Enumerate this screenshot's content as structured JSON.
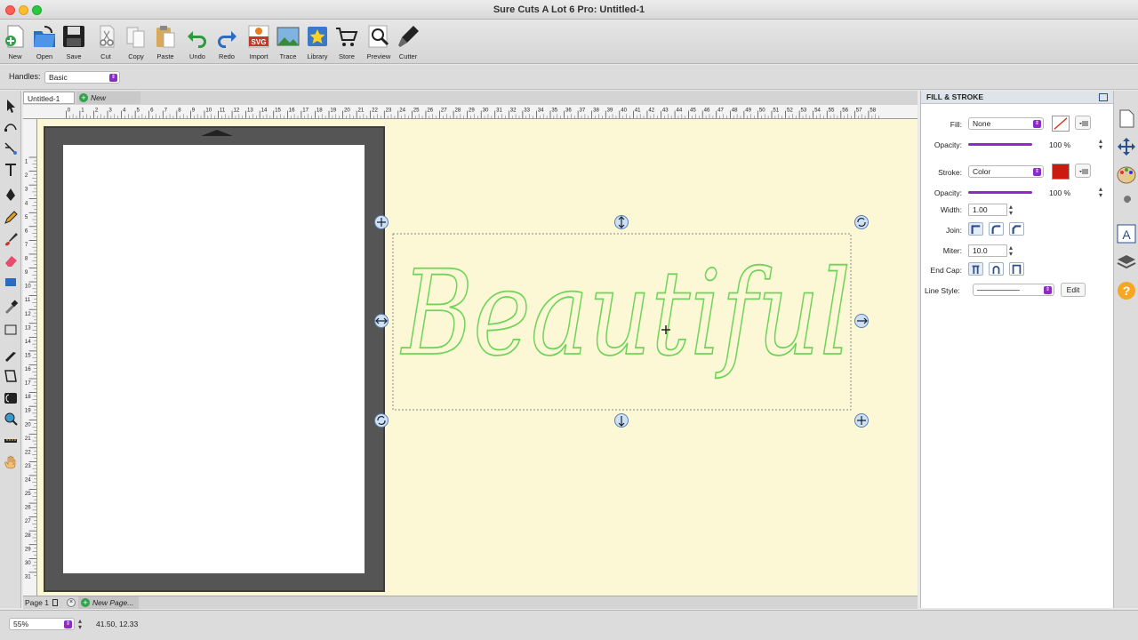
{
  "window": {
    "title": "Sure Cuts A Lot 6 Pro: Untitled-1"
  },
  "toolbar": {
    "items": [
      {
        "label": "New",
        "icon": "new-icon"
      },
      {
        "label": "Open",
        "icon": "open-icon"
      },
      {
        "label": "Save",
        "icon": "save-icon"
      },
      {
        "label": "Cut",
        "icon": "cut-icon"
      },
      {
        "label": "Copy",
        "icon": "copy-icon"
      },
      {
        "label": "Paste",
        "icon": "paste-icon"
      },
      {
        "label": "Undo",
        "icon": "undo-icon"
      },
      {
        "label": "Redo",
        "icon": "redo-icon"
      },
      {
        "label": "Import",
        "icon": "import-svg-icon"
      },
      {
        "label": "Trace",
        "icon": "trace-icon"
      },
      {
        "label": "Library",
        "icon": "library-icon"
      },
      {
        "label": "Store",
        "icon": "store-cart-icon"
      },
      {
        "label": "Preview",
        "icon": "preview-magnifier-icon"
      },
      {
        "label": "Cutter",
        "icon": "cutter-blade-icon"
      }
    ]
  },
  "options": {
    "handles_label": "Handles:",
    "handles_value": "Basic"
  },
  "tabs": {
    "current": "Untitled-1",
    "new_project": "New Project..."
  },
  "ruler": {
    "top_numbers": [
      "0",
      "1",
      "2",
      "3",
      "4",
      "5",
      "6",
      "7",
      "8",
      "9",
      "10",
      "11",
      "12",
      "13",
      "14",
      "15",
      "16",
      "17",
      "18",
      "19",
      "20",
      "21",
      "22",
      "23",
      "24",
      "25",
      "26",
      "27",
      "28",
      "29",
      "30",
      "31",
      "32",
      "33",
      "34",
      "35",
      "36",
      "37",
      "38",
      "39",
      "40",
      "41",
      "42",
      "43",
      "44",
      "45",
      "46",
      "47",
      "48",
      "49",
      "50",
      "51",
      "52",
      "53",
      "54",
      "55",
      "56",
      "57",
      "58"
    ],
    "left_numbers": [
      "1",
      "2",
      "3",
      "4",
      "5",
      "6",
      "7",
      "8",
      "9",
      "10",
      "11",
      "12",
      "13",
      "14",
      "15",
      "16",
      "17",
      "18",
      "19",
      "20",
      "21",
      "22",
      "23",
      "24",
      "25",
      "26",
      "27",
      "28",
      "29",
      "30",
      "31",
      "32"
    ]
  },
  "canvas": {
    "text": "Beautiful",
    "text_color": "#6fd35a",
    "background": "#fcf8d6"
  },
  "pages": {
    "page_label": "Page 1",
    "new_page": "New Page..."
  },
  "status": {
    "zoom": "55%",
    "coords": "41.50, 12.33"
  },
  "panel": {
    "title": "FILL & STROKE",
    "fill_label": "Fill:",
    "fill_value": "None",
    "opacity_label": "Opacity:",
    "fill_opacity": "100 %",
    "stroke_label": "Stroke:",
    "stroke_value": "Color",
    "stroke_color": "#cc1a10",
    "stroke_opacity": "100 %",
    "width_label": "Width:",
    "width_value": "1.00",
    "join_label": "Join:",
    "miter_label": "Miter:",
    "miter_value": "10.0",
    "endcap_label": "End Cap:",
    "linestyle_label": "Line Style:",
    "edit_label": "Edit"
  },
  "colors": {
    "accent": "#8c2bc7",
    "selection_handle": "#cfe0f5"
  }
}
